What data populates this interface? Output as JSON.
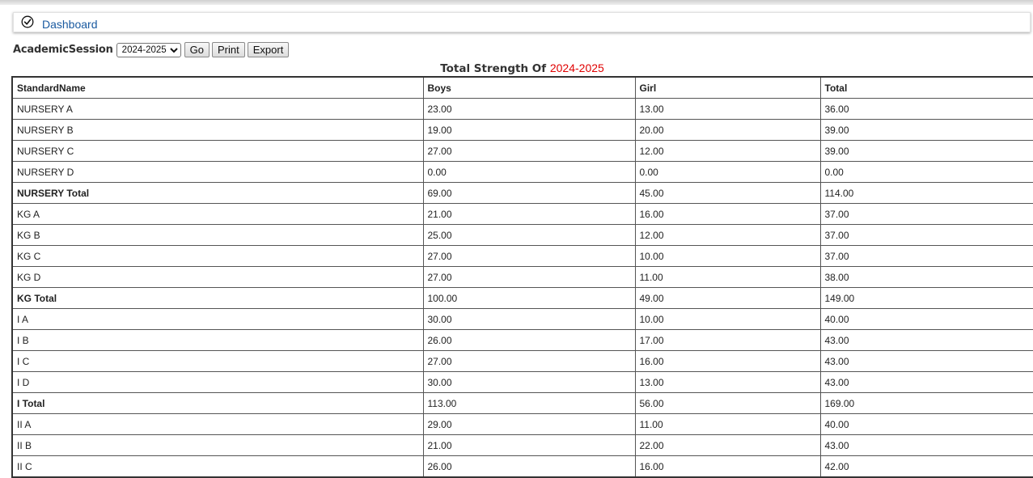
{
  "breadcrumb": {
    "icon": "check-circle-icon",
    "link": "Dashboard"
  },
  "controls": {
    "label": "AcademicSession",
    "session_value": "2024-2025",
    "go_label": "Go",
    "print_label": "Print",
    "export_label": "Export"
  },
  "report": {
    "title_prefix": "Total Strength Of",
    "title_year": "2024-2025",
    "year_color": "#e00000"
  },
  "table": {
    "headers": [
      "StandardName",
      "Boys",
      "Girl",
      "Total"
    ],
    "rows": [
      {
        "name": "NURSERY A",
        "boys": "23.00",
        "girl": "13.00",
        "total": "36.00",
        "is_total": false
      },
      {
        "name": "NURSERY B",
        "boys": "19.00",
        "girl": "20.00",
        "total": "39.00",
        "is_total": false
      },
      {
        "name": "NURSERY C",
        "boys": "27.00",
        "girl": "12.00",
        "total": "39.00",
        "is_total": false
      },
      {
        "name": "NURSERY D",
        "boys": "0.00",
        "girl": "0.00",
        "total": "0.00",
        "is_total": false
      },
      {
        "name": "NURSERY Total",
        "boys": "69.00",
        "girl": "45.00",
        "total": "114.00",
        "is_total": true
      },
      {
        "name": "KG A",
        "boys": "21.00",
        "girl": "16.00",
        "total": "37.00",
        "is_total": false
      },
      {
        "name": "KG B",
        "boys": "25.00",
        "girl": "12.00",
        "total": "37.00",
        "is_total": false
      },
      {
        "name": "KG C",
        "boys": "27.00",
        "girl": "10.00",
        "total": "37.00",
        "is_total": false
      },
      {
        "name": "KG D",
        "boys": "27.00",
        "girl": "11.00",
        "total": "38.00",
        "is_total": false
      },
      {
        "name": "KG Total",
        "boys": "100.00",
        "girl": "49.00",
        "total": "149.00",
        "is_total": true
      },
      {
        "name": "I A",
        "boys": "30.00",
        "girl": "10.00",
        "total": "40.00",
        "is_total": false
      },
      {
        "name": "I B",
        "boys": "26.00",
        "girl": "17.00",
        "total": "43.00",
        "is_total": false
      },
      {
        "name": "I C",
        "boys": "27.00",
        "girl": "16.00",
        "total": "43.00",
        "is_total": false
      },
      {
        "name": "I D",
        "boys": "30.00",
        "girl": "13.00",
        "total": "43.00",
        "is_total": false
      },
      {
        "name": "I Total",
        "boys": "113.00",
        "girl": "56.00",
        "total": "169.00",
        "is_total": true
      },
      {
        "name": "II A",
        "boys": "29.00",
        "girl": "11.00",
        "total": "40.00",
        "is_total": false
      },
      {
        "name": "II B",
        "boys": "21.00",
        "girl": "22.00",
        "total": "43.00",
        "is_total": false
      },
      {
        "name": "II C",
        "boys": "26.00",
        "girl": "16.00",
        "total": "42.00",
        "is_total": false
      }
    ]
  }
}
